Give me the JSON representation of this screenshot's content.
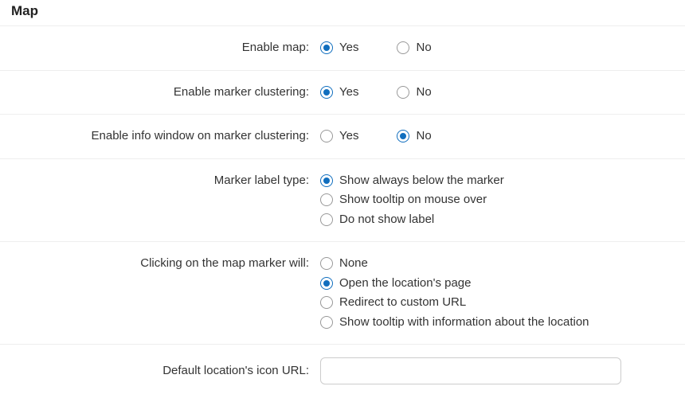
{
  "section_title": "Map",
  "rows": {
    "enable_map": {
      "label": "Enable map:",
      "options": [
        {
          "text": "Yes",
          "checked": true
        },
        {
          "text": "No",
          "checked": false
        }
      ]
    },
    "enable_marker_clustering": {
      "label": "Enable marker clustering:",
      "options": [
        {
          "text": "Yes",
          "checked": true
        },
        {
          "text": "No",
          "checked": false
        }
      ]
    },
    "enable_info_window": {
      "label": "Enable info window on marker clustering:",
      "options": [
        {
          "text": "Yes",
          "checked": false
        },
        {
          "text": "No",
          "checked": true
        }
      ]
    },
    "marker_label_type": {
      "label": "Marker label type:",
      "options": [
        {
          "text": "Show always below the marker",
          "checked": true
        },
        {
          "text": "Show tooltip on mouse over",
          "checked": false
        },
        {
          "text": "Do not show label",
          "checked": false
        }
      ]
    },
    "marker_click": {
      "label": "Clicking on the map marker will:",
      "options": [
        {
          "text": "None",
          "checked": false
        },
        {
          "text": "Open the location's page",
          "checked": true
        },
        {
          "text": "Redirect to custom URL",
          "checked": false
        },
        {
          "text": "Show tooltip with information about the location",
          "checked": false
        }
      ]
    },
    "default_icon_url": {
      "label": "Default location's icon URL:",
      "value": ""
    }
  }
}
